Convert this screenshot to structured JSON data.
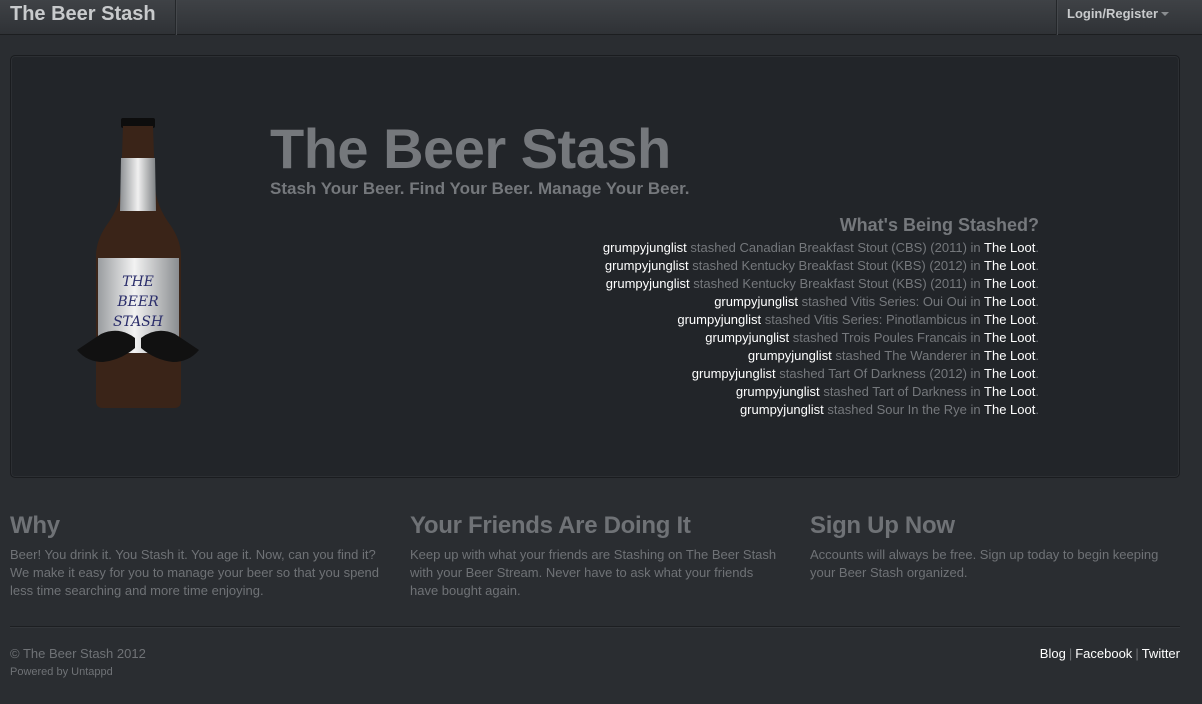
{
  "navbar": {
    "brand": "The Beer Stash",
    "login_label": "Login/Register"
  },
  "hero": {
    "title": "The Beer Stash",
    "tagline": "Stash Your Beer. Find Your Beer. Manage Your Beer.",
    "bottle_label": [
      "THE",
      "BEER",
      "STASH"
    ],
    "stash_heading": "What's Being Stashed?",
    "stash_items": [
      {
        "user": "grumpyjunglist",
        "verb": "stashed",
        "beer": "Canadian Breakfast Stout (CBS) (2011)",
        "in": "in",
        "place": "The Loot"
      },
      {
        "user": "grumpyjunglist",
        "verb": "stashed",
        "beer": "Kentucky Breakfast Stout (KBS) (2012)",
        "in": "in",
        "place": "The Loot"
      },
      {
        "user": "grumpyjunglist",
        "verb": "stashed",
        "beer": "Kentucky Breakfast Stout (KBS) (2011)",
        "in": "in",
        "place": "The Loot"
      },
      {
        "user": "grumpyjunglist",
        "verb": "stashed",
        "beer": "Vitis Series: Oui Oui",
        "in": "in",
        "place": "The Loot"
      },
      {
        "user": "grumpyjunglist",
        "verb": "stashed",
        "beer": "Vitis Series: Pinotlambicus",
        "in": "in",
        "place": "The Loot"
      },
      {
        "user": "grumpyjunglist",
        "verb": "stashed",
        "beer": "Trois Poules Francais",
        "in": "in",
        "place": "The Loot"
      },
      {
        "user": "grumpyjunglist",
        "verb": "stashed",
        "beer": "The Wanderer",
        "in": "in",
        "place": "The Loot"
      },
      {
        "user": "grumpyjunglist",
        "verb": "stashed",
        "beer": "Tart Of Darkness (2012)",
        "in": "in",
        "place": "The Loot"
      },
      {
        "user": "grumpyjunglist",
        "verb": "stashed",
        "beer": "Tart of Darkness",
        "in": "in",
        "place": "The Loot"
      },
      {
        "user": "grumpyjunglist",
        "verb": "stashed",
        "beer": "Sour In the Rye",
        "in": "in",
        "place": "The Loot"
      }
    ]
  },
  "columns": {
    "why": {
      "heading": "Why",
      "text": "Beer! You drink it. You Stash it. You age it. Now, can you find it? We make it easy for you to manage your beer so that you spend less time searching and more time enjoying."
    },
    "friends": {
      "heading": "Your Friends Are Doing It",
      "text": "Keep up with what your friends are Stashing on The Beer Stash with your Beer Stream. Never have to ask what your friends have bought again."
    },
    "signup": {
      "heading": "Sign Up Now",
      "text": "Accounts will always be free. Sign up today to begin keeping your Beer Stash organized."
    }
  },
  "footer": {
    "copyright": "© The Beer Stash 2012",
    "powered": "Powered by Untappd",
    "links": [
      "Blog",
      "Facebook",
      "Twitter"
    ],
    "separator": "|"
  },
  "colors": {
    "background": "#2a2d31",
    "hero_bg": "#222529",
    "muted_text": "#75787c",
    "link": "#ffffff"
  }
}
